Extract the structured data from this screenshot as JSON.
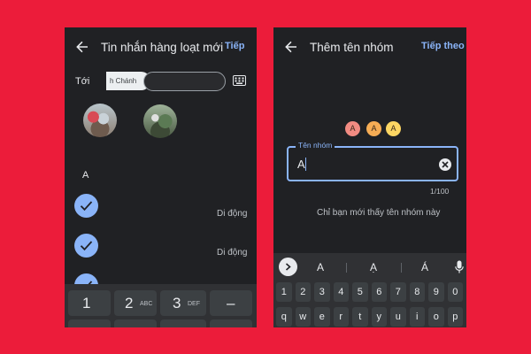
{
  "left_screen": {
    "title": "Tin nhắn hàng loạt mới",
    "next_label": "Tiếp",
    "to_label": "Tới",
    "recipient_chip": "h Chánh",
    "recipient_input_value": "",
    "section_letter": "A",
    "contacts": [
      {
        "selected": true,
        "phone_type": "Di động"
      },
      {
        "selected": true,
        "phone_type": "Di động"
      },
      {
        "selected": true,
        "phone_type": ""
      }
    ],
    "numpad": {
      "keys": [
        {
          "digit": "1",
          "letters": ""
        },
        {
          "digit": "2",
          "letters": "ABC"
        },
        {
          "digit": "3",
          "letters": "DEF"
        },
        {
          "digit": "–",
          "letters": ""
        }
      ]
    }
  },
  "right_screen": {
    "title": "Thêm tên nhóm",
    "next_label": "Tiếp theo",
    "group_avatars": [
      "A",
      "A",
      "A"
    ],
    "group_name_label": "Tên nhóm",
    "group_name_value": "A",
    "char_counter": "1/100",
    "visibility_note": "Chỉ bạn mới thấy tên nhóm này",
    "keyboard": {
      "suggestions": [
        "A",
        "Ạ",
        "Á"
      ],
      "number_row": [
        "1",
        "2",
        "3",
        "4",
        "5",
        "6",
        "7",
        "8",
        "9",
        "0"
      ],
      "letter_row": [
        "q",
        "w",
        "e",
        "r",
        "t",
        "y",
        "u",
        "i",
        "o",
        "p"
      ]
    }
  },
  "colors": {
    "background": "#ec1c3a",
    "screen": "#202124",
    "accent": "#8ab4f8",
    "keyboard": "#303134",
    "key": "#3c4043"
  },
  "icons": [
    "back-arrow-icon",
    "keyboard-icon",
    "checkmark-icon",
    "clear-icon",
    "chevron-right-icon",
    "mic-icon"
  ]
}
